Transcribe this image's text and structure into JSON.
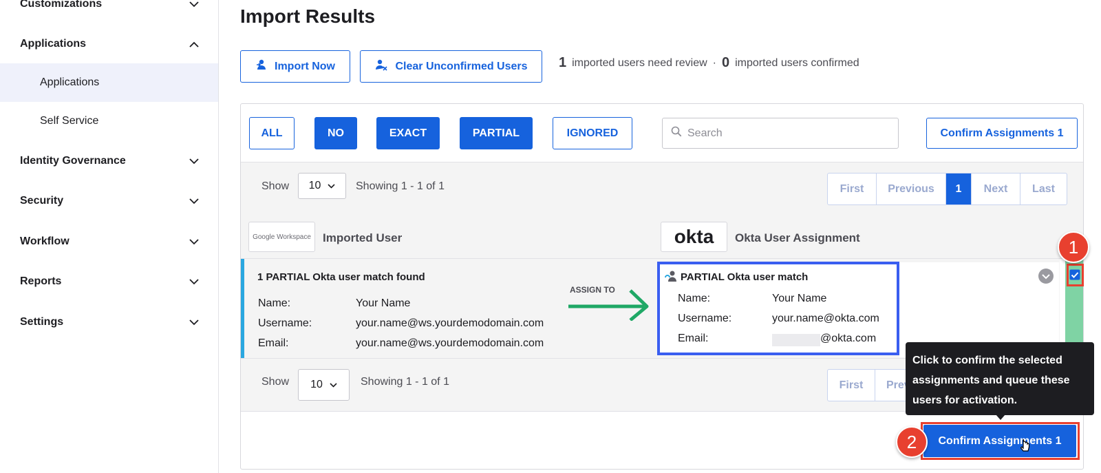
{
  "sidebar": {
    "items": [
      {
        "label": "Customizations"
      },
      {
        "label": "Applications"
      },
      {
        "label": "Identity Governance"
      },
      {
        "label": "Security"
      },
      {
        "label": "Workflow"
      },
      {
        "label": "Reports"
      },
      {
        "label": "Settings"
      }
    ],
    "sub_items": [
      {
        "label": "Applications"
      },
      {
        "label": "Self Service"
      }
    ]
  },
  "page": {
    "title": "Import Results"
  },
  "actions": {
    "import_now": "Import Now",
    "clear_unconfirmed": "Clear Unconfirmed Users"
  },
  "summary": {
    "review_count": "1",
    "review_text": "imported users need review",
    "separator": "·",
    "confirmed_count": "0",
    "confirmed_text": "imported users confirmed"
  },
  "filters": [
    {
      "label": "ALL",
      "active": false
    },
    {
      "label": "NO",
      "active": true
    },
    {
      "label": "EXACT",
      "active": true
    },
    {
      "label": "PARTIAL",
      "active": true
    },
    {
      "label": "IGNORED",
      "active": false
    }
  ],
  "search": {
    "placeholder": "Search"
  },
  "confirm_label": "Confirm Assignments 1",
  "pagination": {
    "show_label": "Show",
    "page_size": "10",
    "showing_text": "Showing 1 - 1 of 1",
    "first": "First",
    "previous": "Previous",
    "current": "1",
    "next": "Next",
    "last": "Last",
    "previous_truncated": "Prev"
  },
  "table_header": {
    "imported_logo": "Google Workspace",
    "imported_label": "Imported User",
    "okta_logo": "okta",
    "okta_label": "Okta User Assignment"
  },
  "match": {
    "title": "1 PARTIAL Okta user match found",
    "name_key": "Name:",
    "name_val": "Your Name",
    "username_key": "Username:",
    "username_val": "your.name@ws.yourdemodomain.com",
    "email_key": "Email:",
    "email_val": "your.name@ws.yourdemodomain.com",
    "assign_to": "ASSIGN TO"
  },
  "okta_match": {
    "title": "PARTIAL Okta user match",
    "name_key": "Name:",
    "name_val": "Your Name",
    "username_key": "Username:",
    "username_val": "your.name@okta.com",
    "email_key": "Email:",
    "email_val": "@okta.com"
  },
  "tooltip": {
    "text": "Click to confirm the selected assignments and queue these users for activation."
  },
  "badges": {
    "step1": "1",
    "step2": "2"
  },
  "colors": {
    "primary": "#1662dd",
    "annotation_red": "#e8402f",
    "arrow_green": "#1fa866",
    "match_bar": "#2aa7e0",
    "okta_card_border": "#3a5ef0"
  }
}
